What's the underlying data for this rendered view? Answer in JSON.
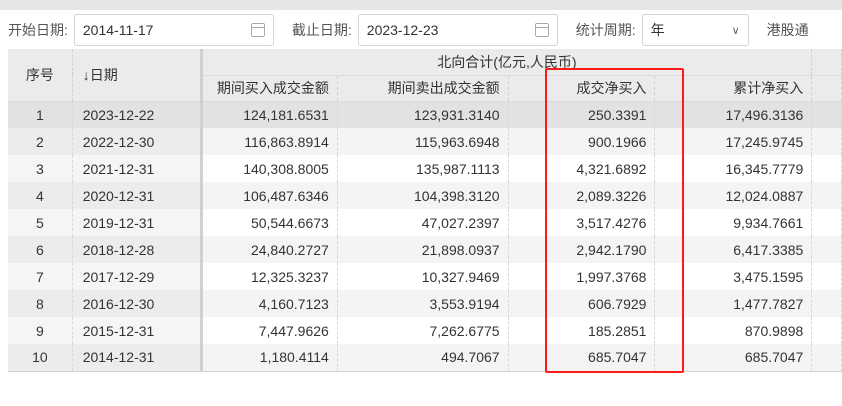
{
  "filters": {
    "start_label": "开始日期:",
    "start_value": "2014-11-17",
    "end_label": "截止日期:",
    "end_value": "2023-12-23",
    "period_label": "统计周期:",
    "period_value": "年",
    "hk_label": "港股通"
  },
  "table": {
    "group_header": "北向合计(亿元,人民币)",
    "col_seq": "序号",
    "col_date": "↓日期",
    "col_buy": "期间买入成交金额",
    "col_sell": "期间卖出成交金额",
    "col_net": "成交净买入",
    "col_cum": "累计净买入",
    "rows": [
      {
        "seq": "1",
        "date": "2023-12-22",
        "buy": "124,181.6531",
        "sell": "123,931.3140",
        "net": "250.3391",
        "cum": "17,496.3136"
      },
      {
        "seq": "2",
        "date": "2022-12-30",
        "buy": "116,863.8914",
        "sell": "115,963.6948",
        "net": "900.1966",
        "cum": "17,245.9745"
      },
      {
        "seq": "3",
        "date": "2021-12-31",
        "buy": "140,308.8005",
        "sell": "135,987.1113",
        "net": "4,321.6892",
        "cum": "16,345.7779"
      },
      {
        "seq": "4",
        "date": "2020-12-31",
        "buy": "106,487.6346",
        "sell": "104,398.3120",
        "net": "2,089.3226",
        "cum": "12,024.0887"
      },
      {
        "seq": "5",
        "date": "2019-12-31",
        "buy": "50,544.6673",
        "sell": "47,027.2397",
        "net": "3,517.4276",
        "cum": "9,934.7661"
      },
      {
        "seq": "6",
        "date": "2018-12-28",
        "buy": "24,840.2727",
        "sell": "21,898.0937",
        "net": "2,942.1790",
        "cum": "6,417.3385"
      },
      {
        "seq": "7",
        "date": "2017-12-29",
        "buy": "12,325.3237",
        "sell": "10,327.9469",
        "net": "1,997.3768",
        "cum": "3,475.1595"
      },
      {
        "seq": "8",
        "date": "2016-12-30",
        "buy": "4,160.7123",
        "sell": "3,553.9194",
        "net": "606.7929",
        "cum": "1,477.7827"
      },
      {
        "seq": "9",
        "date": "2015-12-31",
        "buy": "7,447.9626",
        "sell": "7,262.6775",
        "net": "185.2851",
        "cum": "870.9898"
      },
      {
        "seq": "10",
        "date": "2014-12-31",
        "buy": "1,180.4114",
        "sell": "494.7067",
        "net": "685.7047",
        "cum": "685.7047"
      }
    ]
  },
  "highlight_color": "#ff1a1a"
}
